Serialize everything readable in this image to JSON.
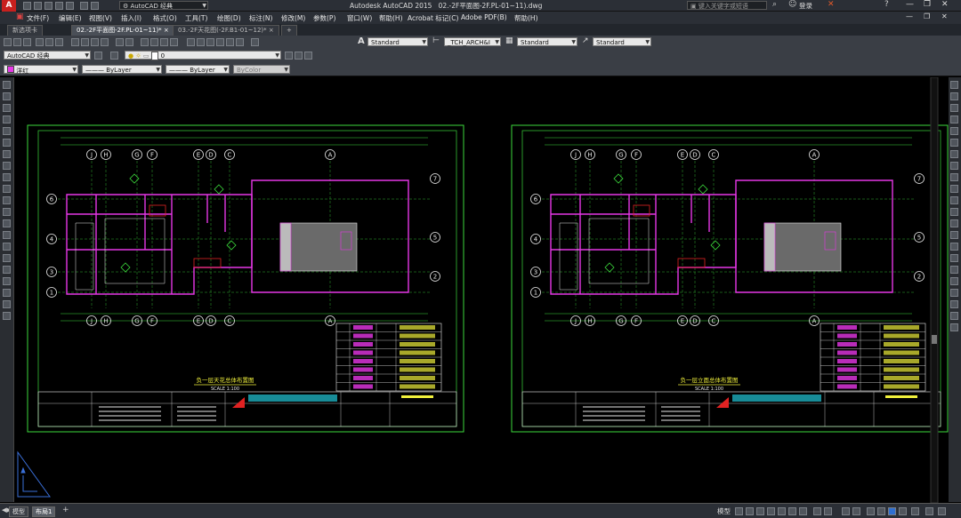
{
  "window": {
    "title": "Autodesk AutoCAD 2015",
    "file": "02.-2F平面图-2F.PL-01~11).dwg",
    "workspace": "AutoCAD 经典",
    "search_placeholder": "键入关键字或短语",
    "signin": "登录"
  },
  "menu": [
    "文件(F)",
    "编辑(E)",
    "视图(V)",
    "插入(I)",
    "格式(O)",
    "工具(T)",
    "绘图(D)",
    "标注(N)",
    "修改(M)",
    "参数(P)",
    "窗口(W)",
    "帮助(H)",
    "Acrobat 标记(C)",
    "Adobe PDF(B)",
    "帮助(H)"
  ],
  "tabs": [
    "新选项卡",
    "02.-2F平面图-2F.PL-01~11)*",
    "03.-2F天花图(-2F.B1-01~12)*"
  ],
  "toolbar1": {
    "text_style": "Standard",
    "dim_style": "_TCH_ARCH&I",
    "table_style": "Standard",
    "mleader_style": "Standard"
  },
  "toolbar2": {
    "workspace": "AutoCAD 经典",
    "layer": "0"
  },
  "toolbar3": {
    "color": "洋红",
    "linetype": "ByLayer",
    "lineweight": "ByLayer",
    "plotstyle": "ByColor"
  },
  "drawings": [
    {
      "title": "负一层天花总体布置图",
      "title_sub": "SCALE 1:100",
      "grid_top": [
        "J",
        "H",
        "G",
        "F",
        "E",
        "D",
        "C",
        "A"
      ],
      "grid_right": [
        "7",
        "5",
        "2"
      ],
      "grid_left": [
        "6",
        "4",
        "3",
        "1"
      ]
    },
    {
      "title": "负一层立面总体布置图",
      "title_sub": "SCALE 1:100",
      "grid_top": [
        "J",
        "H",
        "G",
        "F",
        "E",
        "D",
        "C",
        "A"
      ],
      "grid_right": [
        "7",
        "5",
        "2"
      ],
      "grid_left": [
        "6",
        "4",
        "3",
        "1"
      ]
    }
  ],
  "statusbar": {
    "tabs": [
      "模型",
      "布局1"
    ],
    "model_label": "模型"
  },
  "colors": {
    "green": "#3cd93c",
    "magenta": "#e637e6",
    "yellow": "#f0f03c",
    "white": "#e8e8e8",
    "red": "#e02222",
    "cyan": "#22c8d8"
  }
}
